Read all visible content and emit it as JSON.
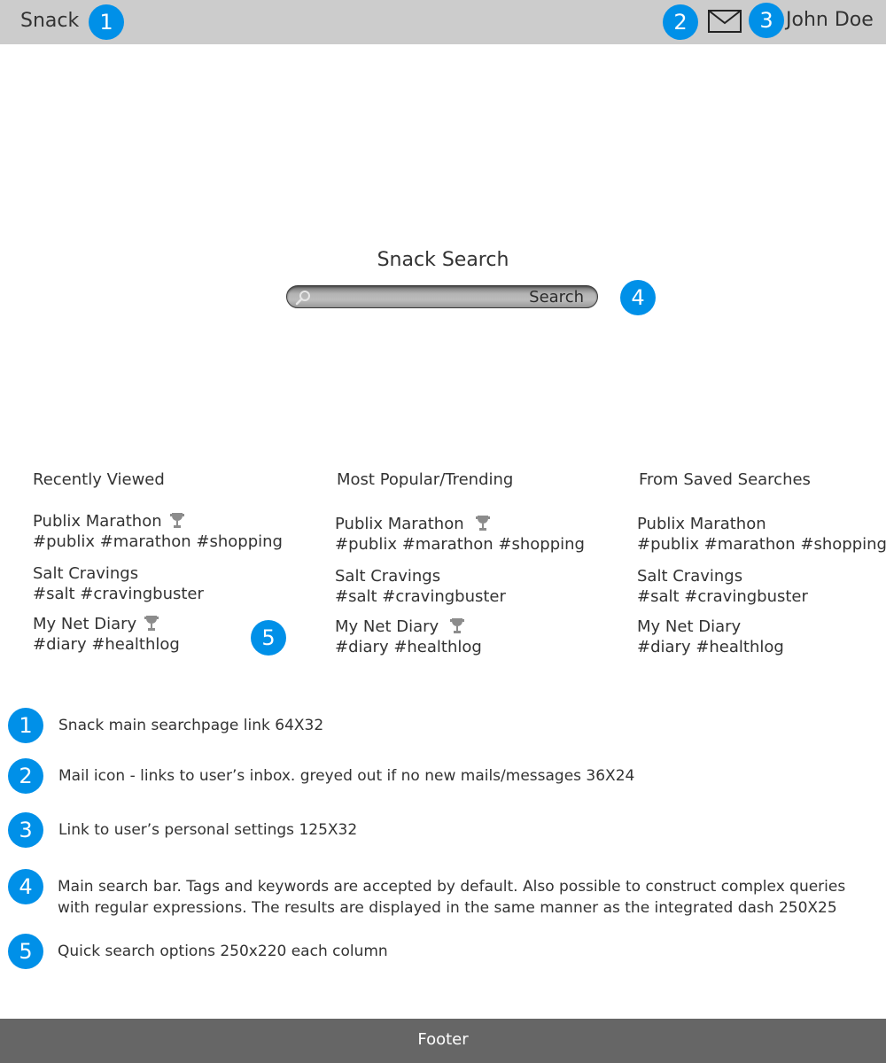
{
  "header": {
    "app_title": "Snack",
    "user_name": "John Doe",
    "mail_icon": "mail-icon",
    "background_color": "#cccccc"
  },
  "annotation_color": "#0090e8",
  "callouts": [
    "1",
    "2",
    "3",
    "4",
    "5"
  ],
  "search": {
    "title": "Snack Search",
    "placeholder": "",
    "button_label": "Search",
    "icon": "magnifier-icon"
  },
  "columns": [
    {
      "title": "Recently Viewed",
      "items": [
        {
          "name": "Publix Marathon",
          "tags": "#publix #marathon #shopping",
          "trophy": true
        },
        {
          "name": "Salt Cravings",
          "tags": "#salt #cravingbuster",
          "trophy": false
        },
        {
          "name": "My Net Diary",
          "tags": "#diary #healthlog",
          "trophy": true
        }
      ]
    },
    {
      "title": "Most Popular/Trending",
      "items": [
        {
          "name": "Publix Marathon",
          "tags": "#publix #marathon #shopping",
          "trophy": true
        },
        {
          "name": "Salt Cravings",
          "tags": "#salt #cravingbuster",
          "trophy": false
        },
        {
          "name": "My Net Diary",
          "tags": "#diary #healthlog",
          "trophy": true
        }
      ]
    },
    {
      "title": "From Saved Searches",
      "items": [
        {
          "name": "Publix Marathon",
          "tags": "#publix #marathon #shopping",
          "trophy": false
        },
        {
          "name": "Salt Cravings",
          "tags": "#salt #cravingbuster",
          "trophy": false
        },
        {
          "name": "My Net Diary",
          "tags": "#diary #healthlog",
          "trophy": false
        }
      ]
    }
  ],
  "legend": [
    {
      "number": "1",
      "text": "Snack main searchpage link 64X32"
    },
    {
      "number": "2",
      "text": "Mail icon - links to user’s inbox. greyed out if no new mails/messages 36X24"
    },
    {
      "number": "3",
      "text": "Link to user’s personal settings 125X32"
    },
    {
      "number": "4",
      "text": "Main search bar. Tags and keywords are accepted by default. Also possible to construct complex queries with regular expressions. The results are displayed in the same manner as the integrated dash 250X25"
    },
    {
      "number": "5",
      "text": "Quick search options 250x220 each column"
    }
  ],
  "footer": {
    "label": "Footer",
    "background_color": "#666666"
  }
}
